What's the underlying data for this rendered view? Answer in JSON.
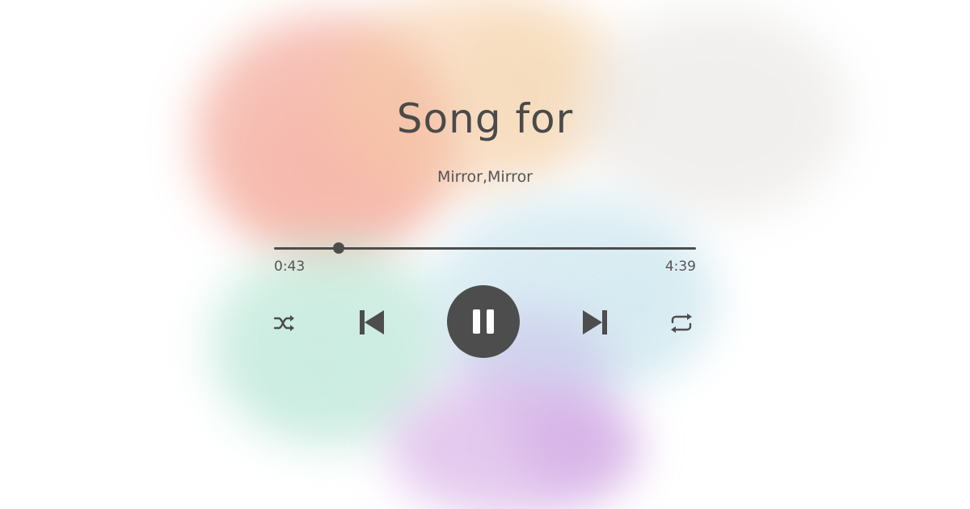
{
  "track": {
    "title": "Song for",
    "artist": "Mirror,Mirror"
  },
  "playback": {
    "elapsed": "0:43",
    "total": "4:39",
    "progress": 0.154,
    "state": "playing"
  },
  "controls": {
    "shuffle_icon": "shuffle-icon",
    "previous_icon": "skip-previous-icon",
    "play_pause_icon": "pause-icon",
    "next_icon": "skip-next-icon",
    "repeat_icon": "repeat-icon"
  },
  "colors": {
    "control": "#4d4d4d",
    "text": "#4a4a4a"
  }
}
